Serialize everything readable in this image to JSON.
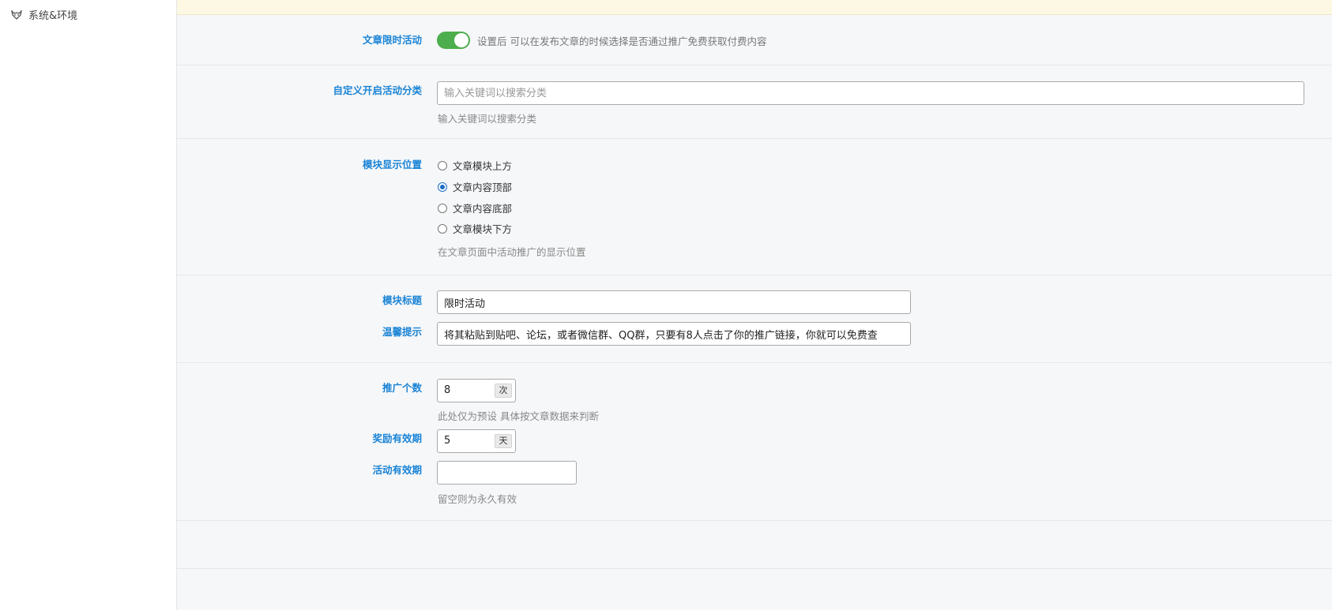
{
  "sidebar": {
    "item": {
      "label": "系统&环境",
      "icon": "fox-logo-icon"
    }
  },
  "sections": {
    "limit_activity": {
      "label": "文章限时活动",
      "enabled": true,
      "description": "设置后 可以在发布文章的时候选择是否通过推广免费获取付费内容"
    },
    "category": {
      "label": "自定义开启活动分类",
      "placeholder": "输入关键词以搜索分类",
      "help": "输入关键词以搜索分类"
    },
    "position": {
      "label": "模块显示位置",
      "options": [
        "文章模块上方",
        "文章内容顶部",
        "文章内容底部",
        "文章模块下方"
      ],
      "selected": "文章内容顶部",
      "help": "在文章页面中活动推广的显示位置"
    },
    "module": {
      "title_label": "模块标题",
      "title_value": "限时活动",
      "tip_label": "温馨提示",
      "tip_value": "将其粘贴到贴吧、论坛，或者微信群、QQ群，只要有8人点击了你的推广链接，你就可以免费查"
    },
    "promotion": {
      "count_label": "推广个数",
      "count_value": "8",
      "count_unit": "次",
      "count_help": "此处仅为预设 具体按文章数据来判断",
      "reward_label": "奖励有效期",
      "reward_value": "5",
      "reward_unit": "天",
      "activity_label": "活动有效期",
      "activity_value": "",
      "activity_help": "留空则为永久有效"
    }
  },
  "colors": {
    "label": "#1a84d6",
    "toggle_on": "#4cae4c",
    "notice_bg": "#fdf8e4"
  }
}
